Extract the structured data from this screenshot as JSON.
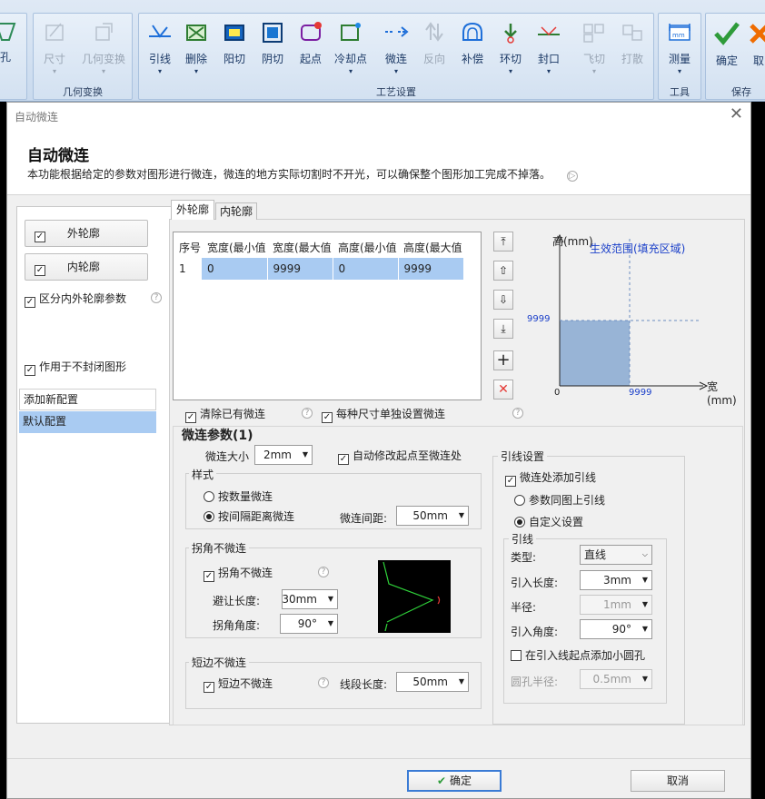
{
  "ribbon": {
    "groups": {
      "geo": "几何变换",
      "process": "工艺设置",
      "tools": "工具",
      "save": "保存"
    },
    "buttons": {
      "hole": "孔",
      "size": "尺寸",
      "geo_transform": "几何变换",
      "lead": "引线",
      "delete": "删除",
      "yang": "阳切",
      "yin": "阴切",
      "start": "起点",
      "cool": "冷却点",
      "micro": "微连",
      "reverse": "反向",
      "comp": "补偿",
      "ring": "环切",
      "seal": "封口",
      "fly": "飞切",
      "scatter": "打散",
      "measure": "测量",
      "ok": "确定",
      "cancel": "取"
    }
  },
  "dialog": {
    "window_title": "自动微连",
    "title": "自动微连",
    "description": "本功能根据给定的参数对图形进行微连，微连的地方实际切割时不开光，可以确保整个图形加工完成不掉落。",
    "left": {
      "outer_btn": "外轮廓",
      "inner_btn": "内轮廓",
      "distinguish": "区分内外轮廓参数",
      "apply_open": "作用于不封闭图形",
      "configs": [
        "添加新配置",
        "默认配置"
      ]
    },
    "tabs": [
      "外轮廓",
      "内轮廓"
    ],
    "table": {
      "headers": [
        "序号",
        "宽度(最小值",
        "宽度(最大值",
        "高度(最小值",
        "高度(最大值"
      ],
      "rows": [
        [
          "1",
          "0",
          "9999",
          "0",
          "9999"
        ]
      ]
    },
    "clear_existing": "清除已有微连",
    "per_size": "每种尺寸单独设置微连",
    "diagram": {
      "y_label": "高(mm)",
      "x_label": "宽(mm)",
      "region_label": "生效范围(填充区域)",
      "y_value": "9999",
      "x_value": "9999",
      "origin": "0"
    },
    "params": {
      "title": "微连参数(1)",
      "size_label": "微连大小",
      "size_value": "2mm",
      "auto_modify": "自动修改起点至微连处",
      "style_legend": "样式",
      "by_count": "按数量微连",
      "by_distance": "按间隔距离微连",
      "gap_label": "微连间距:",
      "gap_value": "50mm",
      "corner_legend": "拐角不微连",
      "corner_check": "拐角不微连",
      "avoid_label": "避让长度:",
      "avoid_value": "30mm",
      "angle_label": "拐角角度:",
      "angle_value": "90°",
      "short_legend": "短边不微连",
      "short_check": "短边不微连",
      "seg_label": "线段长度:",
      "seg_value": "50mm"
    },
    "lead": {
      "legend": "引线设置",
      "add_lead": "微连处添加引线",
      "same_as_above": "参数同图上引线",
      "custom": "自定义设置",
      "sub_legend": "引线",
      "type_label": "类型:",
      "type_value": "直线",
      "len_label": "引入长度:",
      "len_value": "3mm",
      "radius_label": "半径:",
      "radius_value": "1mm",
      "angle_label": "引入角度:",
      "angle_value": "90°",
      "add_hole": "在引入线起点添加小圆孔",
      "hole_label": "圆孔半径:",
      "hole_value": "0.5mm"
    },
    "ok": "确定",
    "cancel": "取消"
  }
}
